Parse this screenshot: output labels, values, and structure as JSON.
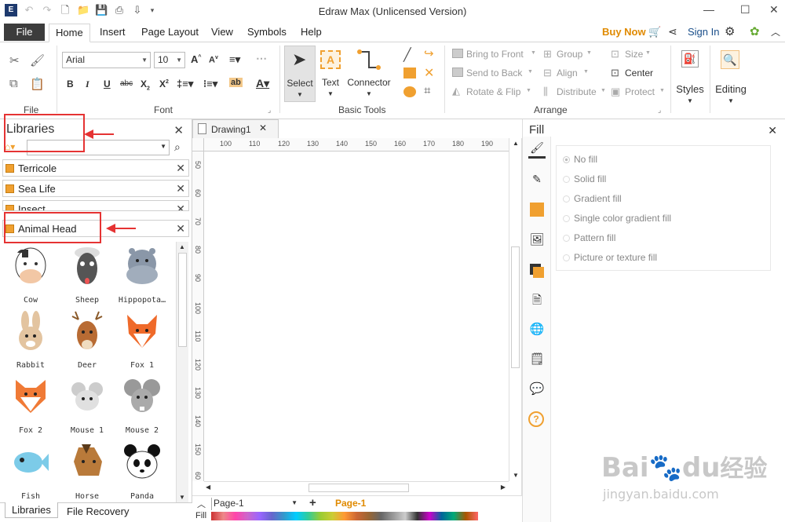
{
  "window": {
    "title": "Edraw Max (Unlicensed Version)"
  },
  "menu": {
    "file": "File",
    "tabs": [
      "Home",
      "Insert",
      "Page Layout",
      "View",
      "Symbols",
      "Help"
    ],
    "active_tab": "Home",
    "buy_now": "Buy Now",
    "sign_in": "Sign In"
  },
  "ribbon": {
    "groups": {
      "file": "File",
      "font": "Font",
      "basic_tools": "Basic Tools",
      "arrange": "Arrange"
    },
    "font": {
      "family": "Arial",
      "size": "10"
    },
    "basic_tools": {
      "select": "Select",
      "text": "Text",
      "connector": "Connector"
    },
    "arrange": {
      "bring_to_front": "Bring to Front",
      "send_to_back": "Send to Back",
      "rotate_flip": "Rotate & Flip",
      "group": "Group",
      "align": "Align",
      "distribute": "Distribute",
      "size": "Size",
      "center": "Center",
      "protect": "Protect"
    },
    "styles": "Styles",
    "editing": "Editing"
  },
  "libraries": {
    "title": "Libraries",
    "items": [
      "Terricole",
      "Sea Life",
      "Insect",
      "Animal Head"
    ],
    "shapes": [
      "Cow",
      "Sheep",
      "Hippopota…",
      "Rabbit",
      "Deer",
      "Fox 1",
      "Fox 2",
      "Mouse 1",
      "Mouse 2",
      "Fish",
      "Horse",
      "Panda"
    ],
    "bottom_tabs": [
      "Libraries",
      "File Recovery"
    ]
  },
  "document": {
    "tab": "Drawing1",
    "ruler_h": [
      "100",
      "110",
      "120",
      "130",
      "140",
      "150",
      "160",
      "170",
      "180",
      "190",
      "2"
    ],
    "ruler_v": [
      "50",
      "60",
      "70",
      "80",
      "90",
      "100",
      "110",
      "120",
      "130",
      "140",
      "150",
      "60"
    ],
    "page_select": "Page-1",
    "page_tab": "Page-1",
    "fill_label": "Fill"
  },
  "fill_panel": {
    "title": "Fill",
    "options": [
      "No fill",
      "Solid fill",
      "Gradient fill",
      "Single color gradient fill",
      "Pattern fill",
      "Picture or texture fill"
    ],
    "selected": "No fill"
  },
  "watermark": {
    "brand": "Bai",
    "brand2": "du",
    "brand3": "经验",
    "url": "jingyan.baidu.com"
  },
  "colors": {
    "accent_orange": "#f0a030",
    "annotation_red": "#e53333",
    "buy_now": "#e08a00",
    "file_tab": "#3c3c3c"
  }
}
